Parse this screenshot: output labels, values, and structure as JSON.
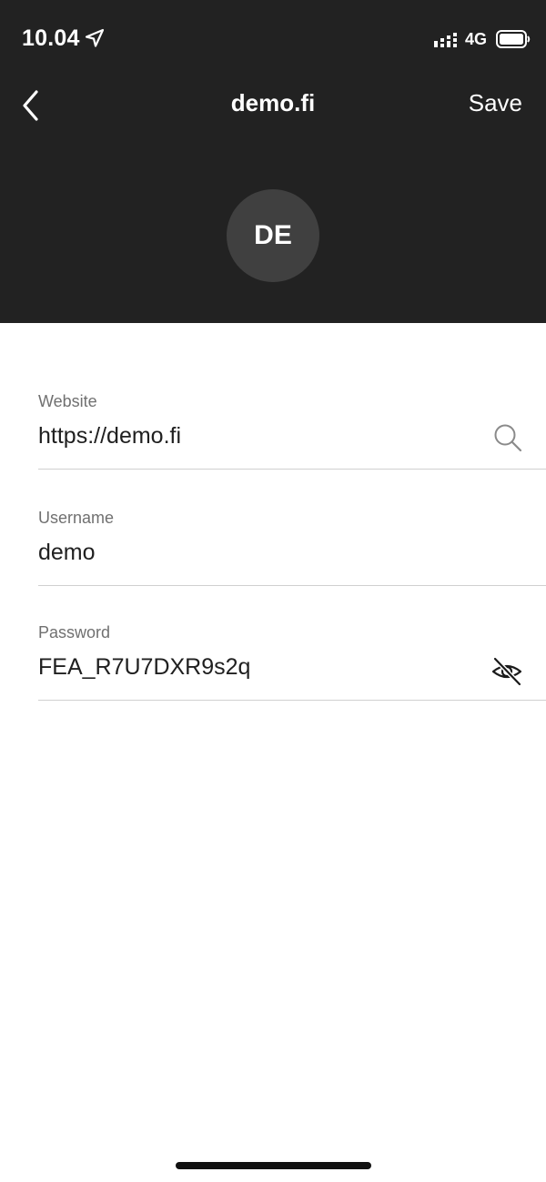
{
  "status_bar": {
    "time": "10.04",
    "network": "4G"
  },
  "nav": {
    "title": "demo.fi",
    "save_label": "Save"
  },
  "avatar": {
    "initials": "DE"
  },
  "fields": {
    "website": {
      "label": "Website",
      "value": "https://demo.fi"
    },
    "username": {
      "label": "Username",
      "value": "demo"
    },
    "password": {
      "label": "Password",
      "value": "FEA_R7U7DXR9s2q"
    }
  },
  "icons": {
    "back": "chevron-left-icon",
    "search": "search-icon",
    "visibility": "eye-off-icon",
    "location": "location-arrow-icon",
    "signal": "signal-icon",
    "battery": "battery-icon"
  },
  "colors": {
    "header_background": "#222222",
    "avatar_background": "#404040",
    "divider": "#d0d0d0"
  }
}
